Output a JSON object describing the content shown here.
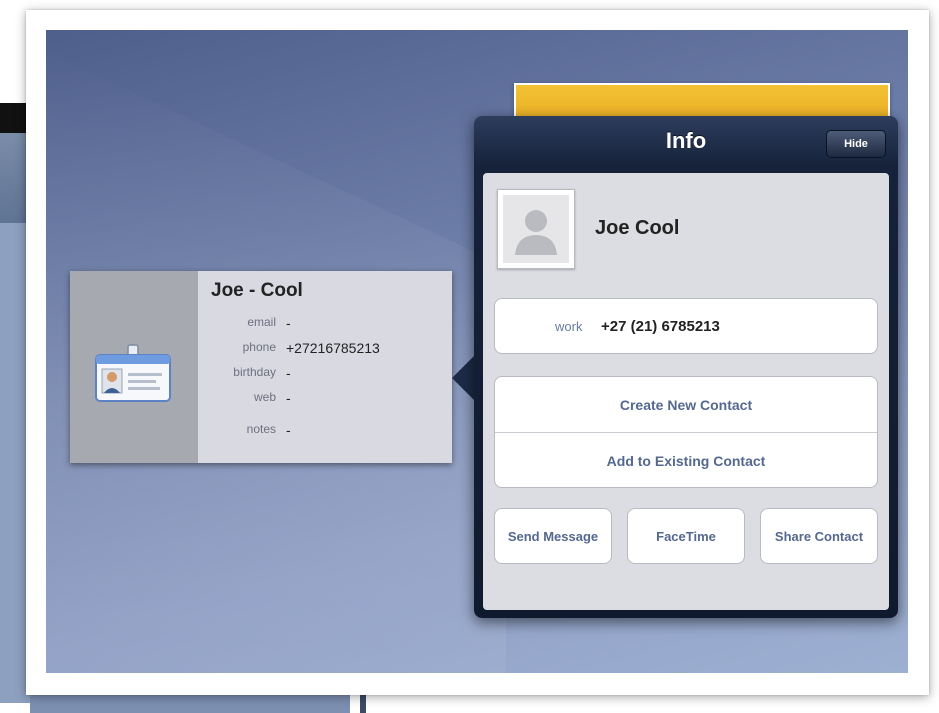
{
  "info_popover": {
    "title": "Info",
    "hide_label": "Hide",
    "contact_name": "Joe Cool",
    "phone": {
      "label": "work",
      "value": "+27 (21) 6785213"
    },
    "actions": [
      "Create New Contact",
      "Add to Existing Contact"
    ],
    "buttons": [
      "Send Message",
      "FaceTime",
      "Share Contact"
    ]
  },
  "contact_card": {
    "name": "Joe - Cool",
    "fields": [
      {
        "label": "email",
        "value": "-"
      },
      {
        "label": "phone",
        "value": "+27216785213"
      },
      {
        "label": "birthday",
        "value": "-"
      },
      {
        "label": "web",
        "value": "-"
      },
      {
        "label": "notes",
        "value": "-"
      }
    ]
  },
  "colors": {
    "popover_bar": "#16223a",
    "action_text": "#55688f",
    "card_bg": "#d9d9e2"
  }
}
